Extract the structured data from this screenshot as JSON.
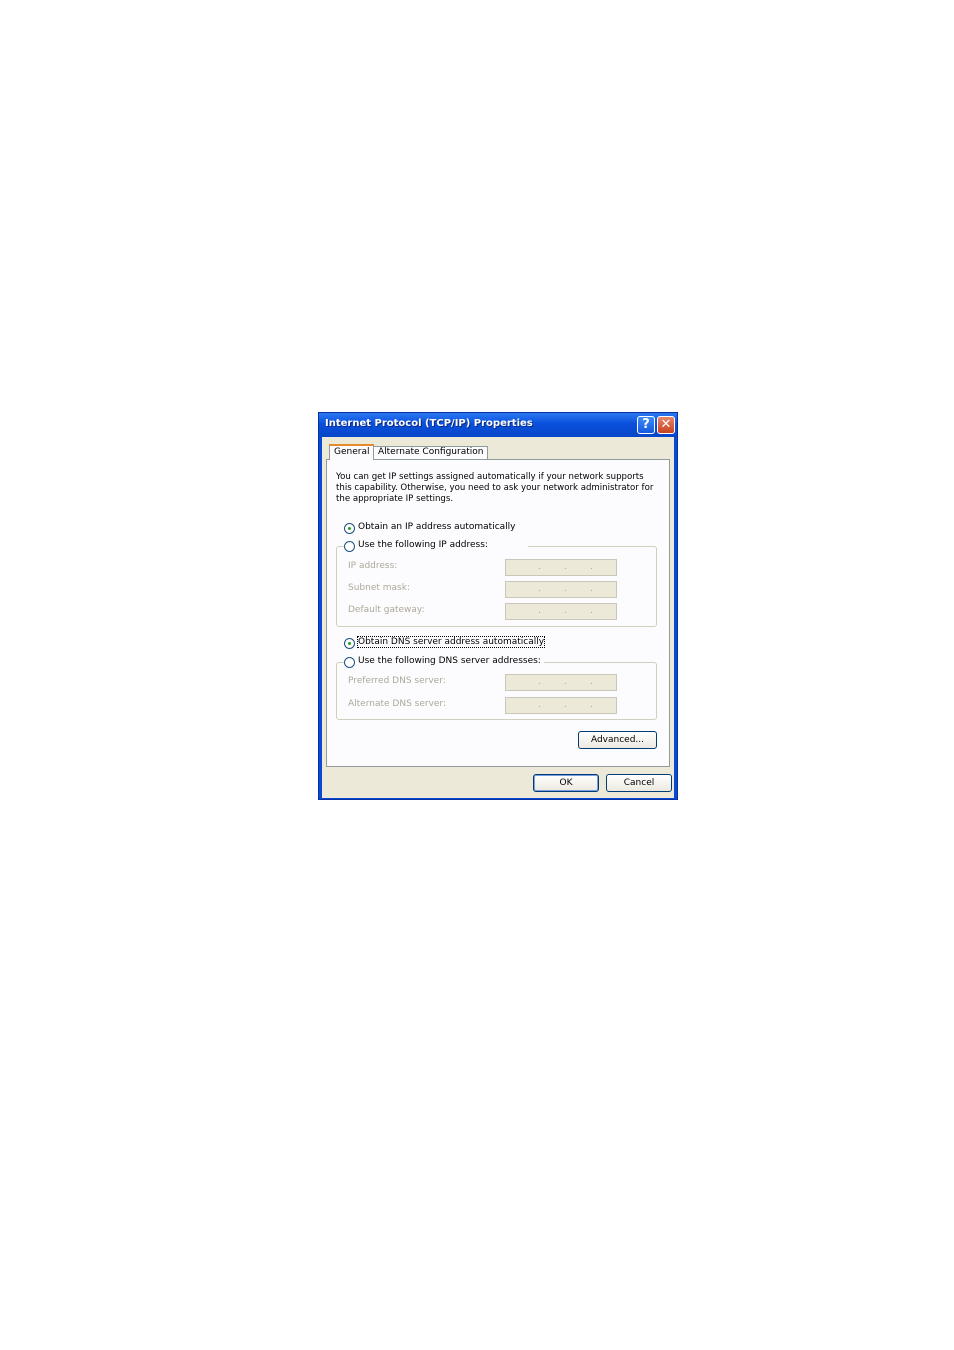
{
  "window": {
    "title": "Internet Protocol (TCP/IP) Properties",
    "help_label": "?",
    "close_label": "✕"
  },
  "tabs": [
    {
      "label": "General"
    },
    {
      "label": "Alternate Configuration"
    }
  ],
  "general": {
    "description": "You can get IP settings assigned automatically if your network supports this capability. Otherwise, you need to ask your network administrator for the appropriate IP settings.",
    "ip_auto_label": "Obtain an IP address automatically",
    "ip_manual_label": "Use the following IP address:",
    "ip_fields": [
      {
        "label": "IP address:"
      },
      {
        "label": "Subnet mask:"
      },
      {
        "label": "Default gateway:"
      }
    ],
    "dns_auto_label": "Obtain DNS server address automatically",
    "dns_manual_label": "Use the following DNS server addresses:",
    "dns_fields": [
      {
        "label": "Preferred DNS server:"
      },
      {
        "label": "Alternate DNS server:"
      }
    ],
    "advanced_label": "Advanced..."
  },
  "footer": {
    "ok_label": "OK",
    "cancel_label": "Cancel"
  },
  "ip_separator": "."
}
